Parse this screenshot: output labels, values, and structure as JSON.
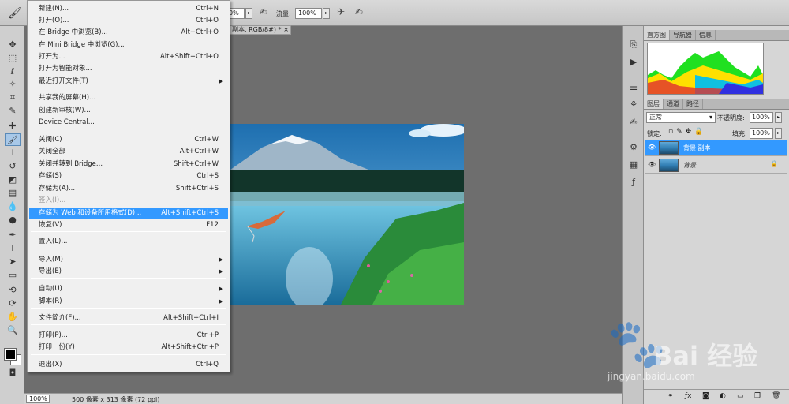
{
  "options_bar": {
    "opacity_value": "0%",
    "flow_label": "流量:",
    "flow_value": "100%"
  },
  "document": {
    "tab_title": "副本, RGB/8#) *",
    "tab_close": "×"
  },
  "status_bar": {
    "zoom": "100%",
    "info": "500 像素 x 313 像素 (72 ppi)"
  },
  "histogram_panel": {
    "tabs": [
      "直方图",
      "导航器",
      "信息"
    ]
  },
  "layers_panel": {
    "tabs": [
      "图层",
      "通道",
      "路径"
    ],
    "blend_mode": "正常",
    "opacity_label": "不透明度:",
    "opacity_value": "100%",
    "lock_label": "锁定:",
    "fill_label": "填充:",
    "fill_value": "100%",
    "layers": [
      {
        "name": "背景 副本",
        "selected": true
      },
      {
        "name": "背景",
        "selected": false
      }
    ]
  },
  "menu": {
    "items": [
      {
        "label": "新建(N)...",
        "shortcut": "Ctrl+N"
      },
      {
        "label": "打开(O)...",
        "shortcut": "Ctrl+O"
      },
      {
        "label": "在 Bridge 中浏览(B)...",
        "shortcut": "Alt+Ctrl+O"
      },
      {
        "label": "在 Mini Bridge 中浏览(G)...",
        "shortcut": ""
      },
      {
        "label": "打开为...",
        "shortcut": "Alt+Shift+Ctrl+O"
      },
      {
        "label": "打开为智能对象...",
        "shortcut": ""
      },
      {
        "label": "最近打开文件(T)",
        "shortcut": "",
        "submenu": true
      },
      {
        "label": "共享我的屏幕(H)...",
        "shortcut": ""
      },
      {
        "label": "创建新审核(W)...",
        "shortcut": ""
      },
      {
        "label": "Device Central...",
        "shortcut": ""
      },
      {
        "label": "关闭(C)",
        "shortcut": "Ctrl+W"
      },
      {
        "label": "关闭全部",
        "shortcut": "Alt+Ctrl+W"
      },
      {
        "label": "关闭并转到 Bridge...",
        "shortcut": "Shift+Ctrl+W"
      },
      {
        "label": "存储(S)",
        "shortcut": "Ctrl+S"
      },
      {
        "label": "存储为(A)...",
        "shortcut": "Shift+Ctrl+S"
      },
      {
        "label": "签入(I)...",
        "shortcut": "",
        "disabled": true
      },
      {
        "label": "存储为 Web 和设备所用格式(D)...",
        "shortcut": "Alt+Shift+Ctrl+S",
        "highlighted": true
      },
      {
        "label": "恢复(V)",
        "shortcut": "F12"
      },
      {
        "label": "置入(L)...",
        "shortcut": ""
      },
      {
        "label": "导入(M)",
        "shortcut": "",
        "submenu": true
      },
      {
        "label": "导出(E)",
        "shortcut": "",
        "submenu": true
      },
      {
        "label": "自动(U)",
        "shortcut": "",
        "submenu": true
      },
      {
        "label": "脚本(R)",
        "shortcut": "",
        "submenu": true
      },
      {
        "label": "文件简介(F)...",
        "shortcut": "Alt+Shift+Ctrl+I"
      },
      {
        "label": "打印(P)...",
        "shortcut": "Ctrl+P"
      },
      {
        "label": "打印一份(Y)",
        "shortcut": "Alt+Shift+Ctrl+P"
      },
      {
        "label": "退出(X)",
        "shortcut": "Ctrl+Q"
      }
    ]
  },
  "watermark": {
    "brand": "Bai 经验",
    "url": "jingyan.baidu.com"
  },
  "colors": {
    "menu_highlight": "#3399ff",
    "selected_layer": "#3399ff",
    "foreground_swatch": "#000000",
    "background_swatch": "#ffffff"
  }
}
